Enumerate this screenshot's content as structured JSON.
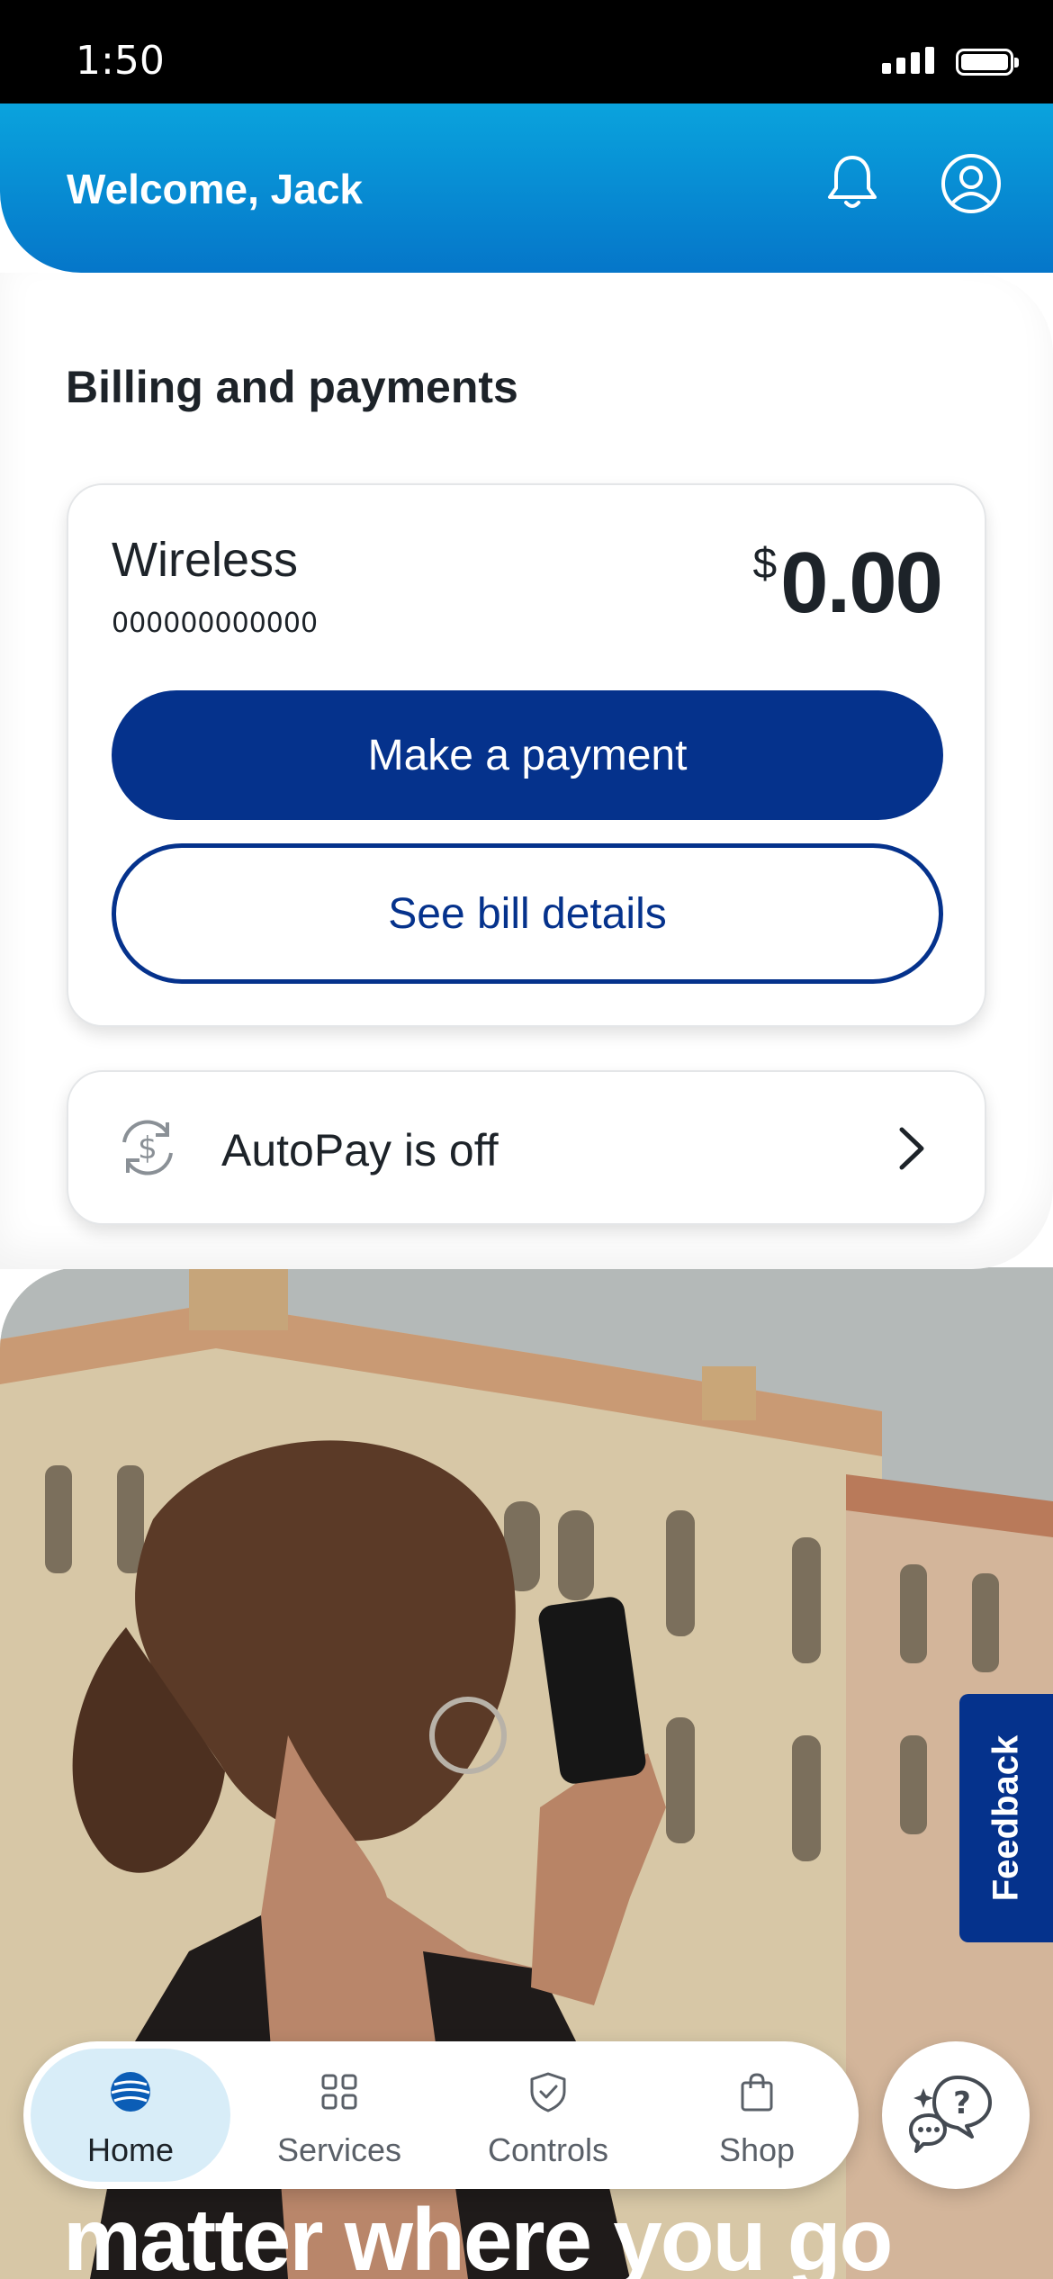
{
  "status_bar": {
    "time": "1:50"
  },
  "header": {
    "welcome": "Welcome, Jack"
  },
  "billing": {
    "section_title": "Billing and payments",
    "account_type": "Wireless",
    "account_number": "000000000000",
    "currency_symbol": "$",
    "amount": "0.00",
    "make_payment_label": "Make a payment",
    "bill_details_label": "See bill details"
  },
  "autopay": {
    "label": "AutoPay is off"
  },
  "hero": {
    "tagline": "matter where you go"
  },
  "feedback": {
    "label": "Feedback"
  },
  "tabs": [
    {
      "label": "Home",
      "icon": "att-globe-icon",
      "active": true
    },
    {
      "label": "Services",
      "icon": "grid-icon",
      "active": false
    },
    {
      "label": "Controls",
      "icon": "shield-check-icon",
      "active": false
    },
    {
      "label": "Shop",
      "icon": "shopping-bag-icon",
      "active": false
    }
  ],
  "colors": {
    "brand_blue": "#05328c",
    "header_blue": "#0aa3dd",
    "active_tab_bg": "#d8edf8",
    "text_dark": "#1d2329"
  }
}
